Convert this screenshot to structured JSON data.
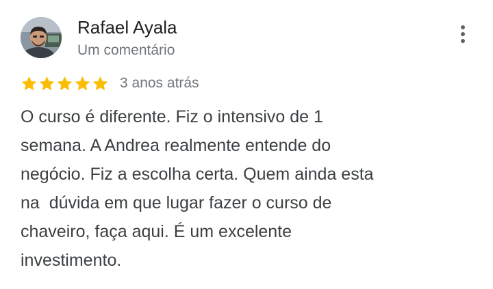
{
  "review": {
    "author": {
      "name": "Rafael Ayala",
      "meta": "Um comentário",
      "avatar": "person-photo"
    },
    "rating": {
      "stars": 5,
      "max": 5,
      "star_color": "#fbbc04",
      "icon": "star-icon"
    },
    "time_ago": "3 anos atrás",
    "menu_icon": "more-vert-icon",
    "text_lines": [
      "O curso é diferente. Fiz o intensivo de 1",
      "semana. A Andrea realmente entende do",
      "negócio. Fiz a escolha certa. Quem ainda esta",
      "na  dúvida em que lugar fazer o curso de",
      "chaveiro, faça aqui. É um excelente",
      "investimento."
    ]
  }
}
